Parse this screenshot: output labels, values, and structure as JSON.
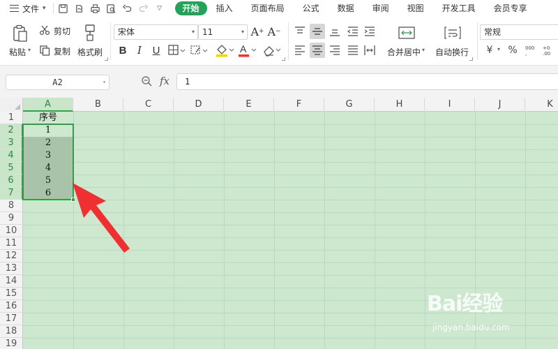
{
  "menubar": {
    "file_label": "文件",
    "tabs": [
      "开始",
      "插入",
      "页面布局",
      "公式",
      "数据",
      "审阅",
      "视图",
      "开发工具",
      "会员专享"
    ],
    "active_tab": "开始"
  },
  "ribbon": {
    "paste_label": "粘贴",
    "cut_label": "剪切",
    "copy_label": "复制",
    "format_painter_label": "格式刷",
    "font_name": "宋体",
    "font_size": "11",
    "merge_label": "合并居中",
    "wrap_label": "自动换行",
    "number_format": "常规",
    "percent_symbol": "%",
    "currency_symbol": "¥"
  },
  "formula_bar": {
    "name_box": "A2",
    "fx_label": "fx",
    "value": "1"
  },
  "sheet": {
    "columns": [
      "A",
      "B",
      "C",
      "D",
      "E",
      "F",
      "G",
      "H",
      "I",
      "J",
      "K"
    ],
    "rows": [
      "1",
      "2",
      "3",
      "4",
      "5",
      "6",
      "7",
      "8",
      "9",
      "10",
      "11",
      "12",
      "13",
      "14",
      "15",
      "16",
      "17",
      "18",
      "19"
    ],
    "cells_A": [
      "序号",
      "1",
      "2",
      "3",
      "4",
      "5",
      "6"
    ],
    "selected_range": "A2:A7",
    "active_color": "#2f9e44"
  },
  "annotation": {
    "arrow_color": "#f03030"
  },
  "watermark": {
    "logo_text": "Bai经验",
    "site": "jingyan.baidu.com"
  }
}
